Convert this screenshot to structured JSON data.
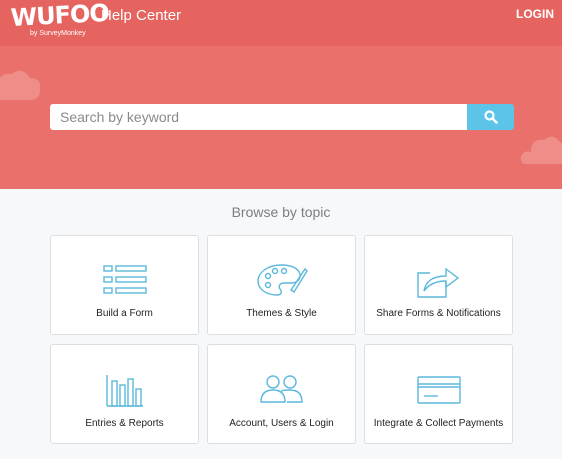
{
  "header": {
    "logo_text": "WUFOO",
    "logo_subtext": "by SurveyMonkey",
    "title": "Help Center",
    "login_label": "LOGIN"
  },
  "search": {
    "placeholder": "Search by keyword",
    "value": "",
    "button_icon": "search-icon"
  },
  "browse": {
    "heading": "Browse by topic",
    "topics": [
      {
        "label": "Build a Form",
        "icon": "form-builder-icon"
      },
      {
        "label": "Themes & Style",
        "icon": "palette-icon"
      },
      {
        "label": "Share Forms & Notifications",
        "icon": "share-icon"
      },
      {
        "label": "Entries & Reports",
        "icon": "bar-chart-icon"
      },
      {
        "label": "Account, Users & Login",
        "icon": "users-icon"
      },
      {
        "label": "Integrate & Collect Payments",
        "icon": "credit-card-icon"
      }
    ]
  },
  "colors": {
    "header_bg": "#e6645f",
    "hero_bg": "#e9706b",
    "accent": "#5bc4e8",
    "icon_stroke": "#5bb9dc"
  }
}
